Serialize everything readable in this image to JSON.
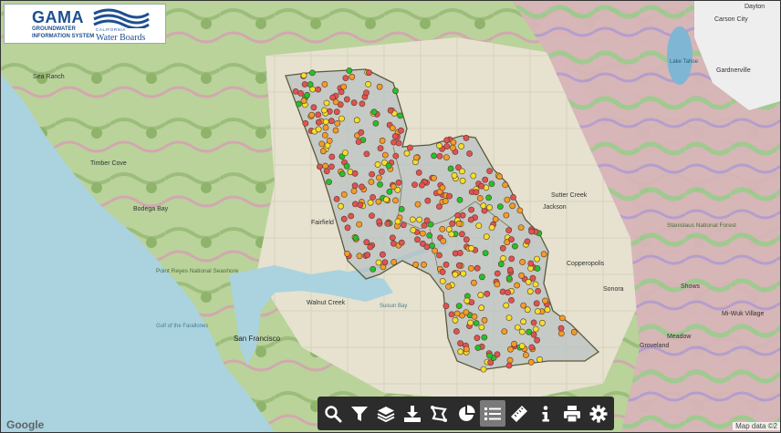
{
  "branding": {
    "gama": "GAMA",
    "line1": "GROUNDWATER",
    "line2": "INFORMATION SYSTEM",
    "board_state": "CALIFORNIA",
    "board_name": "Water Boards"
  },
  "map_labels": {
    "dayton": "Dayton",
    "carson_city": "Carson City",
    "gardnerville": "Gardnerville",
    "lake_tahoe": "Lake Tahoe",
    "sutter_creek": "Sutter Creek",
    "jackson": "Jackson",
    "stanislaus": "Stanislaus National Forest",
    "sonora": "Sonora",
    "copperopolis": "Copperopolis",
    "point_reyes": "Point Reyes National Seashore",
    "gulf_farallones": "Gulf of the Farallones",
    "san_francisco": "San Francisco",
    "suisun_bay": "Suisun Bay",
    "walnut_creek": "Walnut Creek",
    "fairfield": "Fairfield",
    "sea_ranch": "Sea Ranch",
    "timber_cove": "Timber Cove",
    "bodega_bay": "Bodega Bay",
    "mi_wuk": "Mi-Wuk Village",
    "groveland": "Groveland",
    "shows": "Shows",
    "meadow": "Meadow"
  },
  "colors": {
    "basin_fill": "#b7c1c2",
    "basin_stroke": "#5c5a3a",
    "well_red": "#e15252",
    "well_orange": "#f39c26",
    "well_yellow": "#f2e02a",
    "well_green": "#22c22a",
    "toolbar_bg": "#2c2c2c"
  },
  "toolbar": {
    "tools": [
      {
        "name": "search-tool",
        "icon": "search-icon"
      },
      {
        "name": "filter-tool",
        "icon": "filter-icon"
      },
      {
        "name": "layers-tool",
        "icon": "layers-icon"
      },
      {
        "name": "download-tool",
        "icon": "download-icon"
      },
      {
        "name": "select-area-tool",
        "icon": "lasso-icon"
      },
      {
        "name": "chart-tool",
        "icon": "pie-chart-icon"
      },
      {
        "name": "list-tool",
        "icon": "list-icon",
        "active": true
      },
      {
        "name": "measure-tool",
        "icon": "ruler-icon"
      },
      {
        "name": "info-tool",
        "icon": "info-icon"
      },
      {
        "name": "print-tool",
        "icon": "print-icon"
      },
      {
        "name": "settings-tool",
        "icon": "gear-icon"
      }
    ]
  },
  "footer": {
    "google": "Google",
    "attribution": "Map data ©2"
  }
}
